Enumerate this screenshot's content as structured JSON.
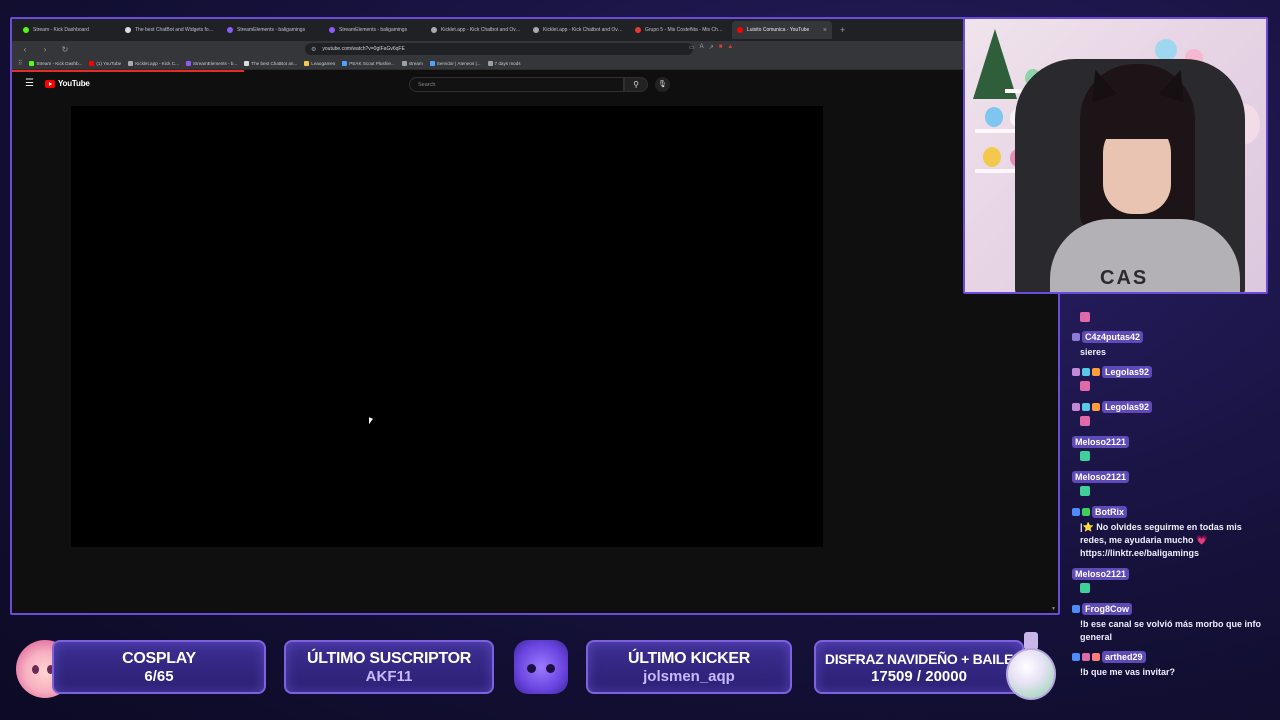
{
  "browser": {
    "tabs": [
      {
        "label": "Stream - Kick Dashboard",
        "color": "#53fc18",
        "active": false
      },
      {
        "label": "The best ChatBot and Widgets for Ki",
        "color": "#dddddd",
        "active": false
      },
      {
        "label": "StreamElements - baligamings",
        "color": "#8b5cf6",
        "active": false
      },
      {
        "label": "StreamElements - baligamings",
        "color": "#8b5cf6",
        "active": false
      },
      {
        "label": "Kicklet.app - Kick Chatbot and Overl",
        "color": "#aaaaaa",
        "active": false
      },
      {
        "label": "Kicklet.app - Kick Chatbot and Overl",
        "color": "#aaaaaa",
        "active": false
      },
      {
        "label": "Grupo 5 - Mis Costeñita - Mis Challe",
        "color": "#e53935",
        "active": false
      },
      {
        "label": "Luisito Comunica - YouTube",
        "color": "#ff0000",
        "active": true
      }
    ],
    "new_tab": "+",
    "back": "‹",
    "forward": "›",
    "reload": "↻",
    "url": "youtube.com/watch?v=0gIFaGv6qFE",
    "bookmarks": [
      {
        "label": "Stream - Kick Dashb...",
        "color": "#53fc18"
      },
      {
        "label": "(1) YouTube",
        "color": "#ff0000"
      },
      {
        "label": "Kicklet.app - Kick C...",
        "color": "#aaaaaa"
      },
      {
        "label": "StreamElements - b...",
        "color": "#8b5cf6"
      },
      {
        "label": "The best ChatBot an...",
        "color": "#dddddd"
      },
      {
        "label": "Leaogames",
        "color": "#f2c94c"
      },
      {
        "label": "PEAK Scout Plushie...",
        "color": "#4da3ff"
      },
      {
        "label": "stream",
        "color": "#9aa0a6"
      },
      {
        "label": "Servidor | Ateneos |...",
        "color": "#4da3ff"
      },
      {
        "label": "7 days mods",
        "color": "#9aa0a6"
      }
    ]
  },
  "youtube": {
    "logo_text": "YouTube",
    "menu_icon": "☰",
    "search_placeholder": "Search",
    "search_icon": "⚲",
    "mic_icon": "●"
  },
  "chat": [
    {
      "user": "",
      "text": "",
      "emote_color": "#e06aa8"
    },
    {
      "user": "C4z4putas42",
      "text": "sieres",
      "badges": [
        "#8a7bd9"
      ]
    },
    {
      "user": "Legolas92",
      "text": "",
      "badges": [
        "#c08ad9",
        "#59c7e8",
        "#ff9d3d"
      ],
      "emote_color": "#e06aa8"
    },
    {
      "user": "Legolas92",
      "text": "",
      "badges": [
        "#c08ad9",
        "#59c7e8",
        "#ff9d3d"
      ],
      "emote_color": "#e06aa8"
    },
    {
      "user": "Meloso2121",
      "text": "",
      "badges": [],
      "emote_color": "#3ecf9a"
    },
    {
      "user": "Meloso2121",
      "text": "",
      "badges": [],
      "emote_color": "#3ecf9a"
    },
    {
      "user": "BotRix",
      "text": "|⭐ No olvides seguirme en todas mis redes, me ayudaria mucho 💗 https://linktr.ee/baligamings",
      "badges": [
        "#4d8cff",
        "#3ecf5a"
      ]
    },
    {
      "user": "Meloso2121",
      "text": "",
      "badges": [],
      "emote_color": "#3ecf9a"
    },
    {
      "user": "Frog8Cow",
      "text": "!b ese canal se volvió más morbo que info general",
      "badges": [
        "#4d8cff"
      ]
    },
    {
      "user": "arthed29",
      "text": "!b que me vas invitar?",
      "badges": [
        "#4d8cff",
        "#e06aa8",
        "#ff7a7a"
      ]
    }
  ],
  "widgets": {
    "cosplay": {
      "title": "COSPLAY",
      "current": "6",
      "sep": "/",
      "goal": "65"
    },
    "last_sub": {
      "title": "ÚLTIMO SUSCRIPTOR",
      "value": "AKF11"
    },
    "last_kicker": {
      "title": "ÚLTIMO KICKER",
      "value": "jolsmen_aqp"
    },
    "goal": {
      "title": "DISFRAZ NAVIDEÑO + BAILE",
      "current": "17509",
      "sep": " / ",
      "target": "20000"
    }
  },
  "webcam": {
    "sweater_text": "CAS"
  }
}
